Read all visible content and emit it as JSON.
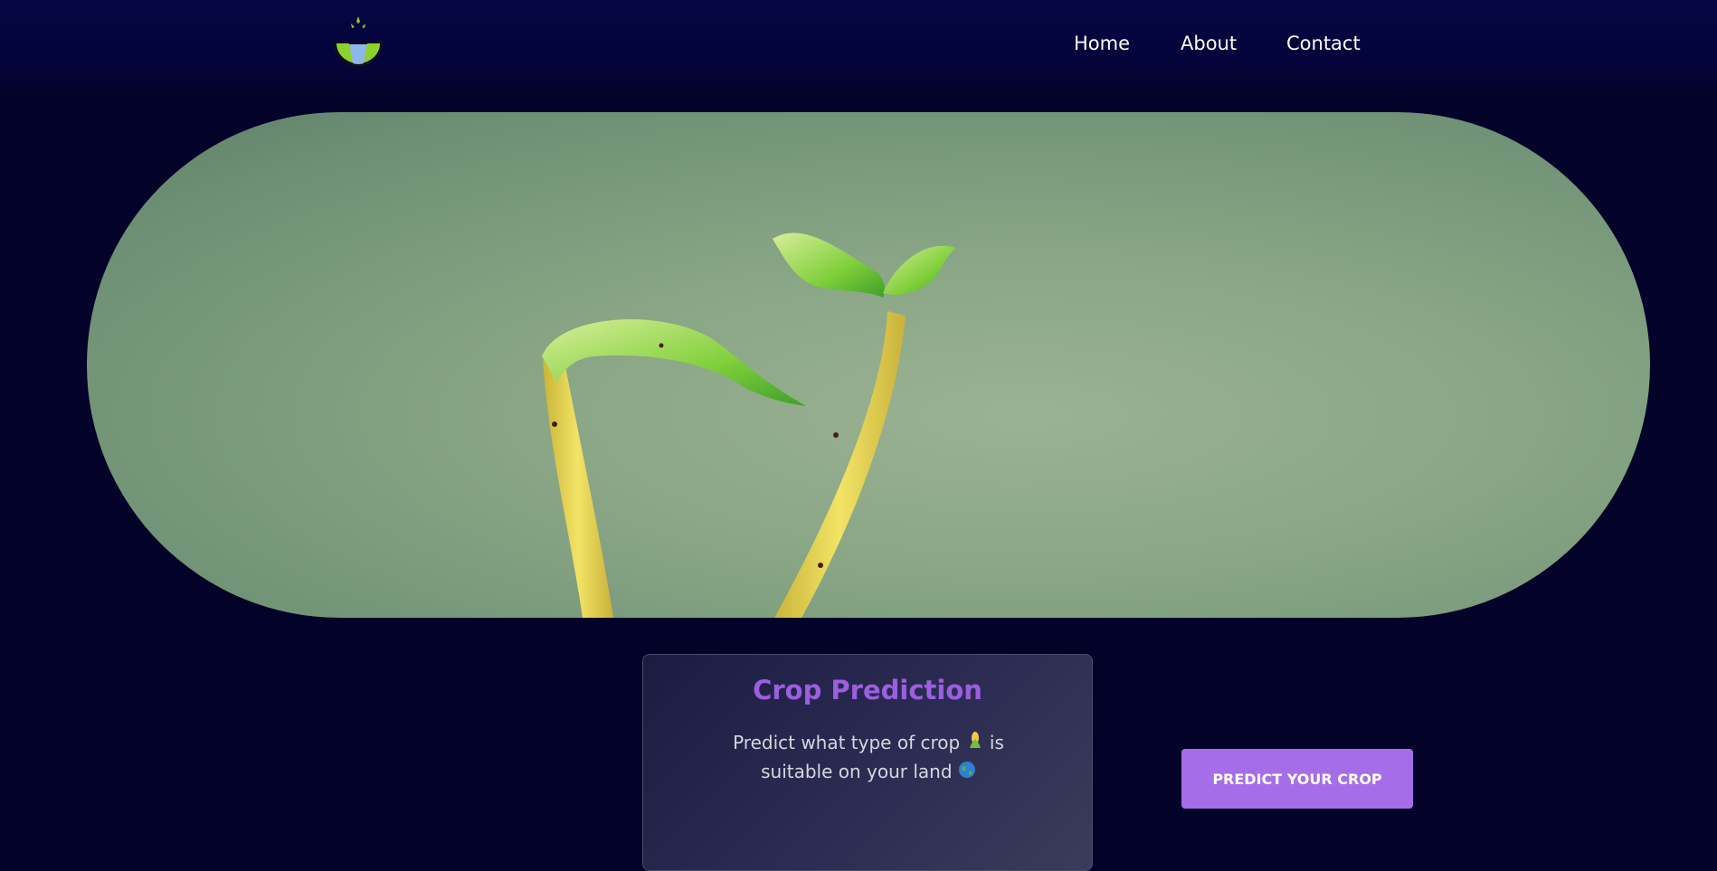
{
  "nav": {
    "logo_icon": "plant-bowl-logo",
    "links": [
      {
        "label": "Home"
      },
      {
        "label": "About"
      },
      {
        "label": "Contact"
      }
    ]
  },
  "hero": {
    "image": "seedling-sprouts-photo"
  },
  "card": {
    "title": "Crop Prediction",
    "desc_part1": "Predict what type of crop",
    "desc_icon1": "corn-emoji-icon",
    "desc_part2": " is suitable on your land",
    "desc_icon2": "globe-emoji-icon"
  },
  "cta": {
    "label": "PREDICT YOUR CROP"
  },
  "colors": {
    "background": "#03032a",
    "navbar": "#050543",
    "accent": "#a56ee8",
    "title": "#9b5fe0"
  }
}
